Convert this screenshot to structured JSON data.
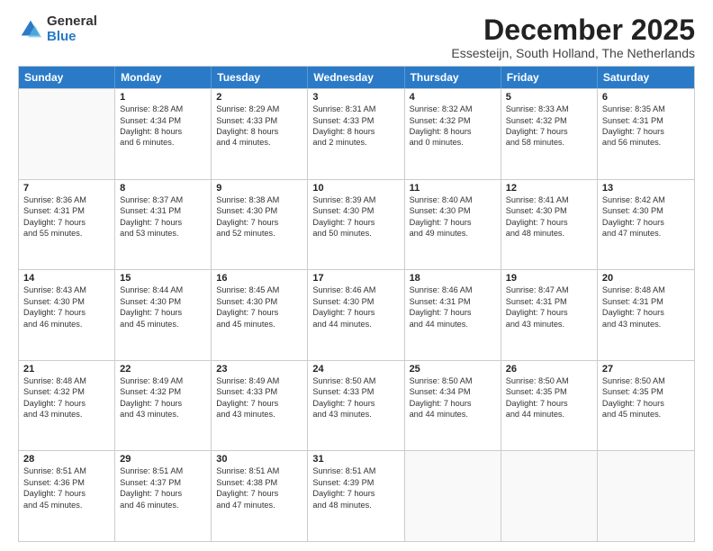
{
  "logo": {
    "general": "General",
    "blue": "Blue"
  },
  "header": {
    "month": "December 2025",
    "location": "Essesteijn, South Holland, The Netherlands"
  },
  "days": [
    "Sunday",
    "Monday",
    "Tuesday",
    "Wednesday",
    "Thursday",
    "Friday",
    "Saturday"
  ],
  "rows": [
    [
      {
        "day": "",
        "empty": true
      },
      {
        "day": "1",
        "lines": [
          "Sunrise: 8:28 AM",
          "Sunset: 4:34 PM",
          "Daylight: 8 hours",
          "and 6 minutes."
        ]
      },
      {
        "day": "2",
        "lines": [
          "Sunrise: 8:29 AM",
          "Sunset: 4:33 PM",
          "Daylight: 8 hours",
          "and 4 minutes."
        ]
      },
      {
        "day": "3",
        "lines": [
          "Sunrise: 8:31 AM",
          "Sunset: 4:33 PM",
          "Daylight: 8 hours",
          "and 2 minutes."
        ]
      },
      {
        "day": "4",
        "lines": [
          "Sunrise: 8:32 AM",
          "Sunset: 4:32 PM",
          "Daylight: 8 hours",
          "and 0 minutes."
        ]
      },
      {
        "day": "5",
        "lines": [
          "Sunrise: 8:33 AM",
          "Sunset: 4:32 PM",
          "Daylight: 7 hours",
          "and 58 minutes."
        ]
      },
      {
        "day": "6",
        "lines": [
          "Sunrise: 8:35 AM",
          "Sunset: 4:31 PM",
          "Daylight: 7 hours",
          "and 56 minutes."
        ]
      }
    ],
    [
      {
        "day": "7",
        "lines": [
          "Sunrise: 8:36 AM",
          "Sunset: 4:31 PM",
          "Daylight: 7 hours",
          "and 55 minutes."
        ]
      },
      {
        "day": "8",
        "lines": [
          "Sunrise: 8:37 AM",
          "Sunset: 4:31 PM",
          "Daylight: 7 hours",
          "and 53 minutes."
        ]
      },
      {
        "day": "9",
        "lines": [
          "Sunrise: 8:38 AM",
          "Sunset: 4:30 PM",
          "Daylight: 7 hours",
          "and 52 minutes."
        ]
      },
      {
        "day": "10",
        "lines": [
          "Sunrise: 8:39 AM",
          "Sunset: 4:30 PM",
          "Daylight: 7 hours",
          "and 50 minutes."
        ]
      },
      {
        "day": "11",
        "lines": [
          "Sunrise: 8:40 AM",
          "Sunset: 4:30 PM",
          "Daylight: 7 hours",
          "and 49 minutes."
        ]
      },
      {
        "day": "12",
        "lines": [
          "Sunrise: 8:41 AM",
          "Sunset: 4:30 PM",
          "Daylight: 7 hours",
          "and 48 minutes."
        ]
      },
      {
        "day": "13",
        "lines": [
          "Sunrise: 8:42 AM",
          "Sunset: 4:30 PM",
          "Daylight: 7 hours",
          "and 47 minutes."
        ]
      }
    ],
    [
      {
        "day": "14",
        "lines": [
          "Sunrise: 8:43 AM",
          "Sunset: 4:30 PM",
          "Daylight: 7 hours",
          "and 46 minutes."
        ]
      },
      {
        "day": "15",
        "lines": [
          "Sunrise: 8:44 AM",
          "Sunset: 4:30 PM",
          "Daylight: 7 hours",
          "and 45 minutes."
        ]
      },
      {
        "day": "16",
        "lines": [
          "Sunrise: 8:45 AM",
          "Sunset: 4:30 PM",
          "Daylight: 7 hours",
          "and 45 minutes."
        ]
      },
      {
        "day": "17",
        "lines": [
          "Sunrise: 8:46 AM",
          "Sunset: 4:30 PM",
          "Daylight: 7 hours",
          "and 44 minutes."
        ]
      },
      {
        "day": "18",
        "lines": [
          "Sunrise: 8:46 AM",
          "Sunset: 4:31 PM",
          "Daylight: 7 hours",
          "and 44 minutes."
        ]
      },
      {
        "day": "19",
        "lines": [
          "Sunrise: 8:47 AM",
          "Sunset: 4:31 PM",
          "Daylight: 7 hours",
          "and 43 minutes."
        ]
      },
      {
        "day": "20",
        "lines": [
          "Sunrise: 8:48 AM",
          "Sunset: 4:31 PM",
          "Daylight: 7 hours",
          "and 43 minutes."
        ]
      }
    ],
    [
      {
        "day": "21",
        "lines": [
          "Sunrise: 8:48 AM",
          "Sunset: 4:32 PM",
          "Daylight: 7 hours",
          "and 43 minutes."
        ]
      },
      {
        "day": "22",
        "lines": [
          "Sunrise: 8:49 AM",
          "Sunset: 4:32 PM",
          "Daylight: 7 hours",
          "and 43 minutes."
        ]
      },
      {
        "day": "23",
        "lines": [
          "Sunrise: 8:49 AM",
          "Sunset: 4:33 PM",
          "Daylight: 7 hours",
          "and 43 minutes."
        ]
      },
      {
        "day": "24",
        "lines": [
          "Sunrise: 8:50 AM",
          "Sunset: 4:33 PM",
          "Daylight: 7 hours",
          "and 43 minutes."
        ]
      },
      {
        "day": "25",
        "lines": [
          "Sunrise: 8:50 AM",
          "Sunset: 4:34 PM",
          "Daylight: 7 hours",
          "and 44 minutes."
        ]
      },
      {
        "day": "26",
        "lines": [
          "Sunrise: 8:50 AM",
          "Sunset: 4:35 PM",
          "Daylight: 7 hours",
          "and 44 minutes."
        ]
      },
      {
        "day": "27",
        "lines": [
          "Sunrise: 8:50 AM",
          "Sunset: 4:35 PM",
          "Daylight: 7 hours",
          "and 45 minutes."
        ]
      }
    ],
    [
      {
        "day": "28",
        "lines": [
          "Sunrise: 8:51 AM",
          "Sunset: 4:36 PM",
          "Daylight: 7 hours",
          "and 45 minutes."
        ]
      },
      {
        "day": "29",
        "lines": [
          "Sunrise: 8:51 AM",
          "Sunset: 4:37 PM",
          "Daylight: 7 hours",
          "and 46 minutes."
        ]
      },
      {
        "day": "30",
        "lines": [
          "Sunrise: 8:51 AM",
          "Sunset: 4:38 PM",
          "Daylight: 7 hours",
          "and 47 minutes."
        ]
      },
      {
        "day": "31",
        "lines": [
          "Sunrise: 8:51 AM",
          "Sunset: 4:39 PM",
          "Daylight: 7 hours",
          "and 48 minutes."
        ]
      },
      {
        "day": "",
        "empty": true
      },
      {
        "day": "",
        "empty": true
      },
      {
        "day": "",
        "empty": true
      }
    ]
  ]
}
